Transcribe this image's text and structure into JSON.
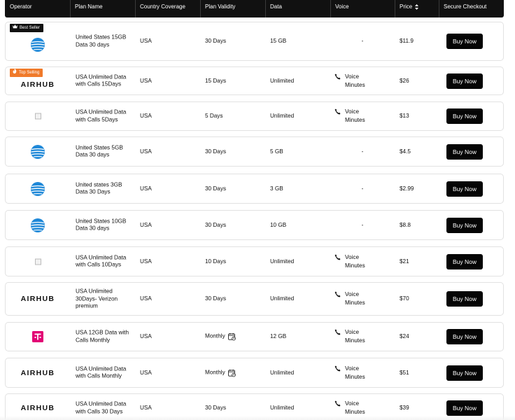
{
  "header": {
    "columns": [
      "Operator",
      "Plan Name",
      "Country Coverage",
      "Plan Validity",
      "Data",
      "Voice",
      "Price",
      "Secure Checkout"
    ]
  },
  "badges": {
    "best_seller": "Best Seller",
    "top_selling": "Top Selling"
  },
  "airhub_logo_text": "AIRHUB",
  "buy_label": "Buy Now",
  "voice_label": [
    "Voice",
    "Minutes"
  ],
  "colors": {
    "header_bg": "#111111",
    "button_bg": "#050505",
    "top_selling_badge": "#f07a2a",
    "att_blue": "#1e88d8",
    "tmobile_magenta": "#e20074"
  },
  "rows": [
    {
      "operator": "att-logo",
      "plan": "United States 15GB Data 30 days",
      "country": "USA",
      "validity": "30 Days",
      "data": "15 GB",
      "voice": "-",
      "price": "$11.9",
      "badge": "best_seller"
    },
    {
      "operator": "airhub-logo",
      "plan": "USA Unlimited Data with Calls 15Days",
      "country": "USA",
      "validity": "15 Days",
      "data": "Unlimited",
      "voice": "Voice Minutes",
      "price": "$26",
      "badge": "top_selling"
    },
    {
      "operator": "broken-image",
      "plan": "USA Unlimited Data with Calls 5Days",
      "country": "USA",
      "validity": "5 Days",
      "data": "Unlimited",
      "voice": "Voice Minutes",
      "price": "$13"
    },
    {
      "operator": "att-logo",
      "plan": "United States 5GB Data 30 days",
      "country": "USA",
      "validity": "30 Days",
      "data": "5 GB",
      "voice": "-",
      "price": "$4.5"
    },
    {
      "operator": "att-logo",
      "plan": "United states 3GB Data 30 Days",
      "country": "USA",
      "validity": "30 Days",
      "data": "3 GB",
      "voice": "-",
      "price": "$2.99"
    },
    {
      "operator": "att-logo",
      "plan": "United States 10GB Data 30 days",
      "country": "USA",
      "validity": "30 Days",
      "data": "10 GB",
      "voice": "-",
      "price": "$8.8"
    },
    {
      "operator": "broken-image",
      "plan": "USA Unlimited Data with Calls 10Days",
      "country": "USA",
      "validity": "10 Days",
      "data": "Unlimited",
      "voice": "Voice Minutes",
      "price": "$21"
    },
    {
      "operator": "airhub-logo",
      "plan": "USA Unlimited 30Days- Verizon premium",
      "country": "USA",
      "validity": "30 Days",
      "data": "Unlimited",
      "voice": "Voice Minutes",
      "price": "$70"
    },
    {
      "operator": "tmobile-logo",
      "plan": "USA 12GB Data with Calls Monthly",
      "country": "USA",
      "validity": "Monthly",
      "data": "12 GB",
      "voice": "Voice Minutes",
      "price": "$24",
      "calendar": true
    },
    {
      "operator": "airhub-logo",
      "plan": "USA Unlimited Data with Calls Monthly",
      "country": "USA",
      "validity": "Monthly",
      "data": "Unlimited",
      "voice": "Voice Minutes",
      "price": "$51",
      "calendar": true
    },
    {
      "operator": "airhub-logo",
      "plan": "USA Unlimited Data with Calls 30 Days",
      "country": "USA",
      "validity": "30 Days",
      "data": "Unlimited",
      "voice": "Voice Minutes",
      "price": "$39"
    }
  ]
}
